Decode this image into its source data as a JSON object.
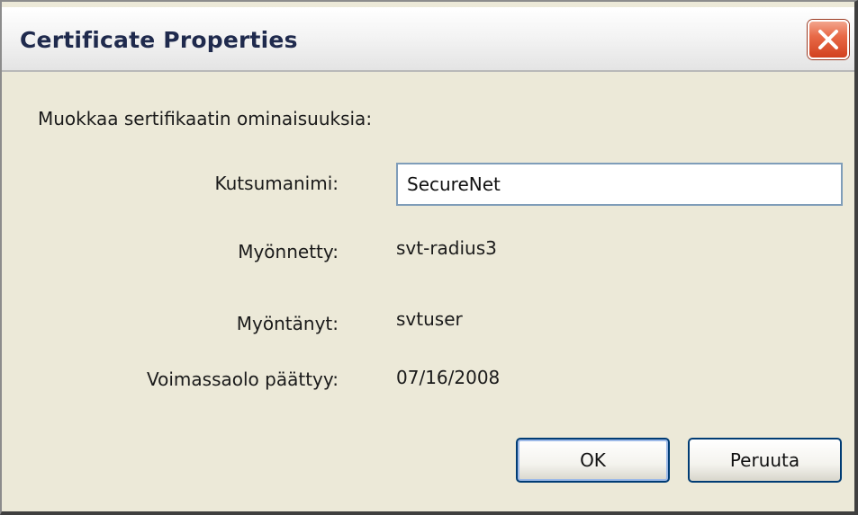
{
  "window": {
    "title": "Certificate Properties"
  },
  "form": {
    "prompt": "Muokkaa sertifikaatin ominaisuuksia:",
    "friendly_name_label": "Kutsumanimi:",
    "friendly_name_value": "SecureNet",
    "issued_to_label": "Myönnetty:",
    "issued_to_value": "svt-radius3",
    "issued_by_label": "Myöntänyt:",
    "issued_by_value": "svtuser",
    "expires_label": "Voimassaolo päättyy:",
    "expires_value": "07/16/2008"
  },
  "buttons": {
    "ok_label": "OK",
    "cancel_label": "Peruuta"
  },
  "icons": {
    "close": "close-icon"
  },
  "colors": {
    "dialog_background": "#ece9d8",
    "close_button": "#e86a48",
    "input_border": "#7f9db9",
    "button_border": "#003c74"
  }
}
